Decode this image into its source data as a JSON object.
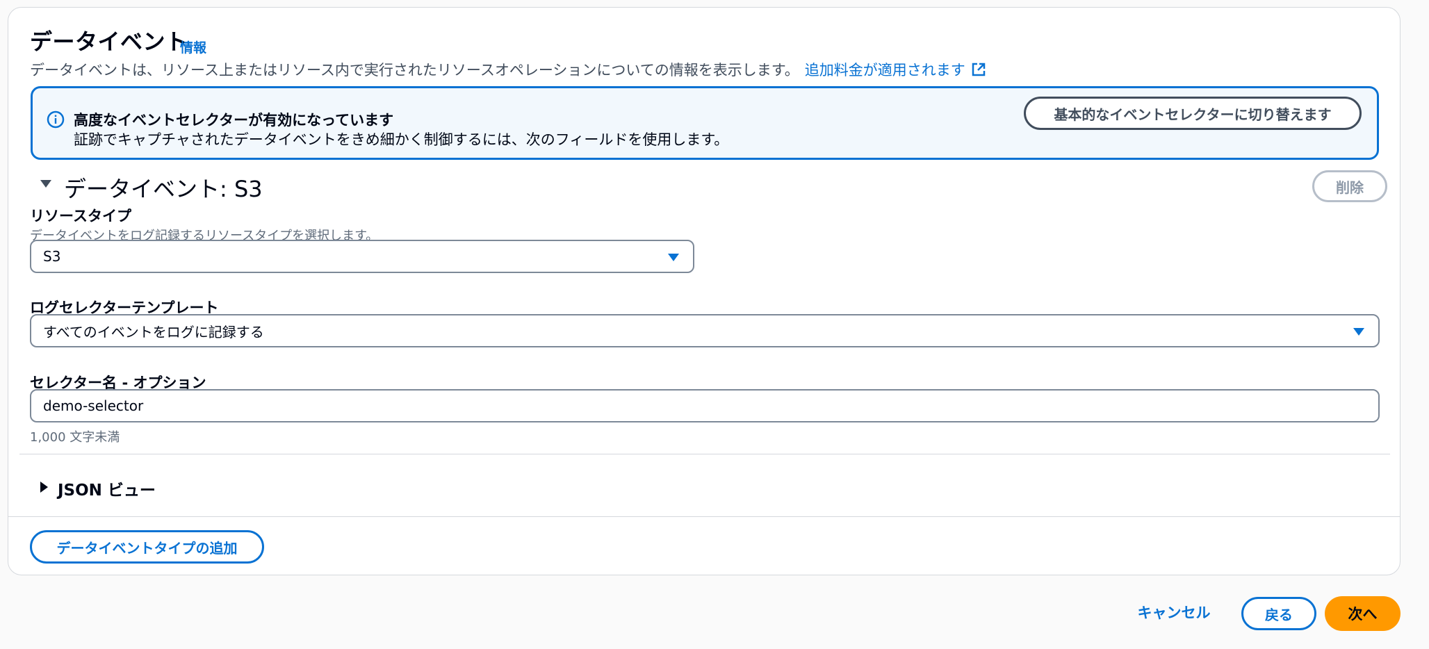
{
  "header": {
    "title": "データイベント",
    "info_link": "情報",
    "description": "データイベントは、リソース上またはリソース内で実行されたリソースオペレーションについての情報を表示します。",
    "pricing_link": "追加料金が適用されます",
    "pricing_link_icon": "external-link-icon"
  },
  "alert": {
    "icon": "info-icon",
    "title": "高度なイベントセレクターが有効になっています",
    "body": "証跡でキャプチャされたデータイベントをきめ細かく制御するには、次のフィールドを使用します。",
    "switch_button": "基本的なイベントセレクターに切り替えます"
  },
  "section": {
    "title": "データイベント: S3",
    "remove_button": "削除",
    "resource_type": {
      "label": "リソースタイプ",
      "description": "データイベントをログ記録するリソースタイプを選択します。",
      "value": "S3"
    },
    "log_selector_template": {
      "label": "ログセレクターテンプレート",
      "value": "すべてのイベントをログに記録する"
    },
    "selector_name": {
      "label": "セレクター名 - オプション",
      "value": "demo-selector",
      "constraint": "1,000 文字未満"
    },
    "json_view": "JSON ビュー"
  },
  "add_button": "データイベントタイプの追加",
  "footer": {
    "cancel": "キャンセル",
    "back": "戻る",
    "next": "次へ"
  },
  "colors": {
    "accent": "#0972d3",
    "primary_button": "#ff9900",
    "alert_background": "#f2f8fd"
  }
}
